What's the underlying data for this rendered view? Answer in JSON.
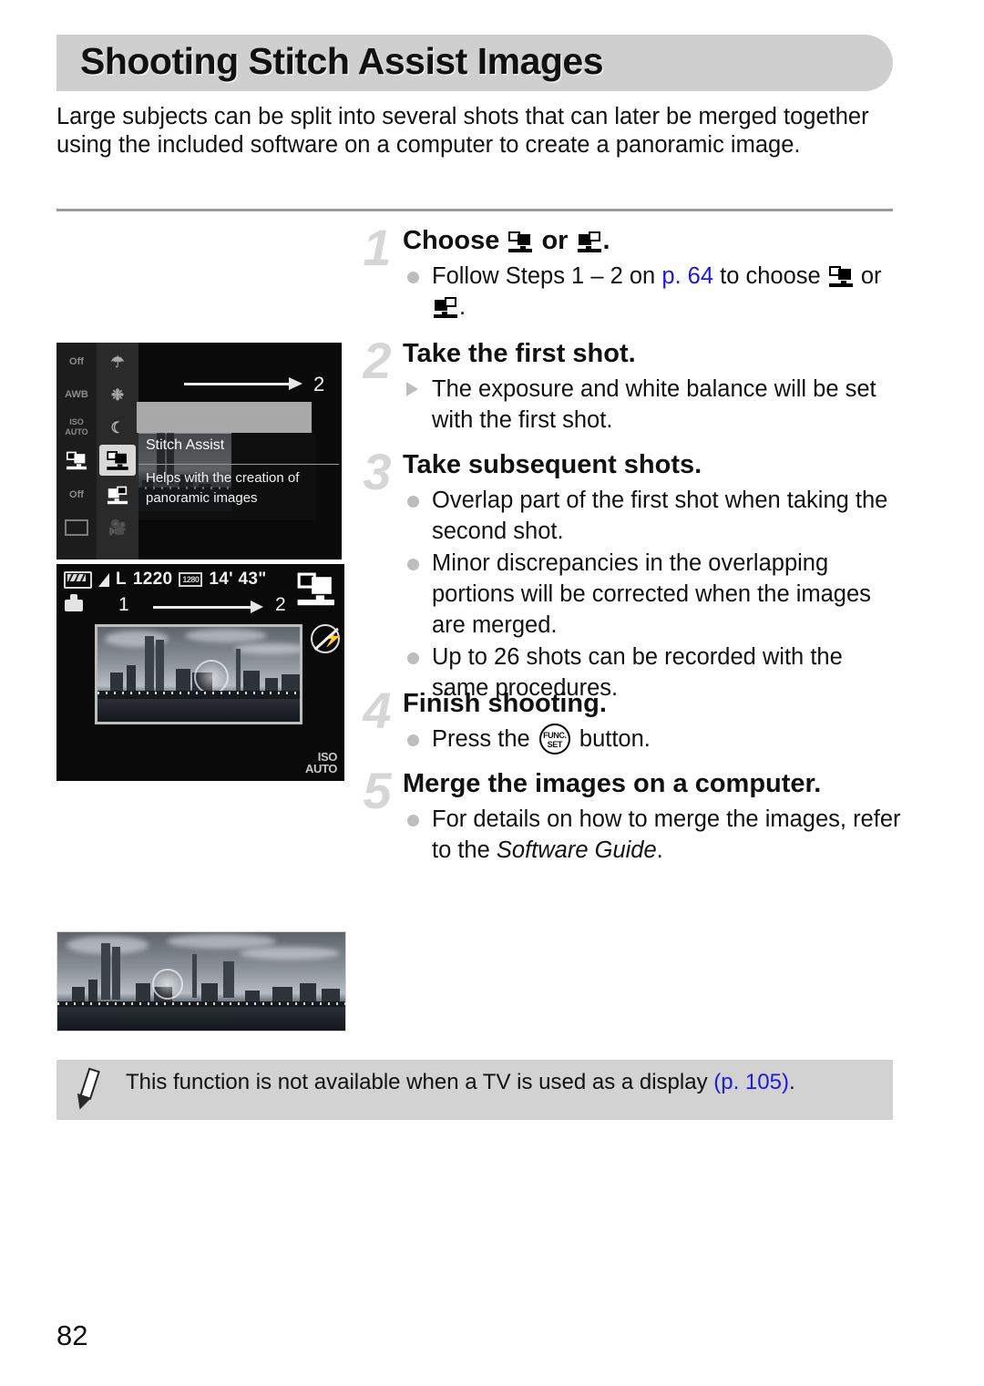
{
  "page": {
    "title": "Shooting Stitch Assist Images",
    "intro": "Large subjects can be split into several shots that can later be merged together using the included software on a computer to create a panoramic image.",
    "page_number": "82"
  },
  "steps": [
    {
      "number": "1",
      "heading_pre": "Choose ",
      "heading_mid": " or ",
      "heading_post": ".",
      "bullets": [
        {
          "marker": "dot",
          "pre": "Follow Steps 1 – 2 on ",
          "link": "p. 64",
          "mid": " to choose ",
          "post": " or ",
          "end": "."
        }
      ]
    },
    {
      "number": "2",
      "heading": "Take the first shot.",
      "bullets": [
        {
          "marker": "triangle",
          "text": "The exposure and white balance will be set with the first shot."
        }
      ]
    },
    {
      "number": "3",
      "heading": "Take subsequent shots.",
      "bullets": [
        {
          "marker": "dot",
          "text": "Overlap part of the first shot when taking the second shot."
        },
        {
          "marker": "dot",
          "text": "Minor discrepancies in the overlapping portions will be corrected when the images are merged."
        },
        {
          "marker": "dot",
          "text": "Up to 26 shots can be recorded with the same procedures."
        }
      ]
    },
    {
      "number": "4",
      "heading": "Finish shooting.",
      "bullets": [
        {
          "marker": "dot",
          "pre": "Press the ",
          "post": " button."
        }
      ]
    },
    {
      "number": "5",
      "heading": "Merge the images on a computer.",
      "bullets": [
        {
          "marker": "dot",
          "pre": "For details on how to merge the images, refer to the ",
          "italic": "Software Guide",
          "post": "."
        }
      ]
    }
  ],
  "figures": {
    "menu": {
      "name": "camera-menu-screen",
      "left_column_icons": [
        "Off",
        "AWB",
        "ISO AUTO",
        "stitch-assist-icon",
        "Off",
        "screen-icon"
      ],
      "right_column_icons": [
        "snow-icon",
        "fireworks-icon",
        "night-scene-icon",
        "stitch-assist-lr-icon",
        "stitch-assist-rl-icon",
        "movie-icon"
      ],
      "selected_item": "stitch-assist-lr-icon",
      "mode_label": "Stitch Assist",
      "mode_description": "Helps with the creation of panoramic images",
      "sequence_number": "2"
    },
    "lcd": {
      "name": "camera-lcd-screen",
      "battery": "battery-full-icon",
      "quality": "L",
      "shots_remaining": "1220",
      "resolution_badge": "1280",
      "recording_time": "14' 43\"",
      "stitch_icon": "stitch-assist-lr-icon",
      "flash_icon": "flash-off-icon",
      "iso_line1": "ISO",
      "iso_line2": "AUTO",
      "sequence_from": "1",
      "sequence_to": "2"
    },
    "panorama": {
      "name": "merged-panorama-photo"
    }
  },
  "note": {
    "pre": "This function is not available when a TV is used as a display ",
    "link": "(p. 105)",
    "post": "."
  },
  "colors": {
    "banner": "#cfcfcf",
    "link": "#1a1ae6",
    "step_number": "#d6d6d6",
    "note_background": "#d2d2d2",
    "rule": "#9a9a9a"
  }
}
